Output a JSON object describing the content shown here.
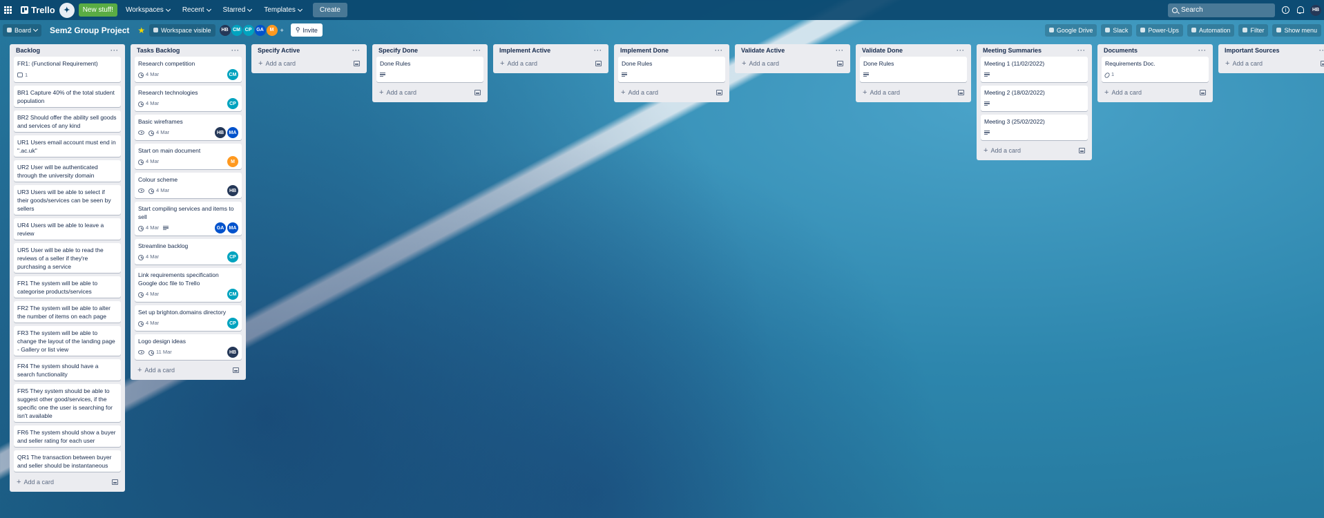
{
  "topbar": {
    "logo": "Trello",
    "new_stuff": "New stuff!",
    "workspaces": "Workspaces",
    "recent": "Recent",
    "starred": "Starred",
    "templates": "Templates",
    "create": "Create",
    "search_placeholder": "Search",
    "info": "i",
    "user_initials": "HB"
  },
  "board": {
    "view": "Board",
    "title": "Sem2 Group Project",
    "visibility": "Workspace visible",
    "members": [
      "HB",
      "CM",
      "CP",
      "GA",
      "M"
    ],
    "invite": "Invite",
    "google_drive": "Google Drive",
    "slack": "Slack",
    "powerups": "Power-Ups",
    "automation": "Automation",
    "filter": "Filter",
    "show_menu": "Show menu",
    "add_card": "Add a card"
  },
  "lists": [
    {
      "name": "Backlog",
      "cards": [
        {
          "title": "FR1: (Functional Requirement)",
          "comments": "1"
        },
        {
          "title": "BR1 Capture 40% of the total student population"
        },
        {
          "title": "BR2 Should offer the ability sell goods and services of any kind"
        },
        {
          "title": "UR1 Users email account must end in \".ac.uk\""
        },
        {
          "title": "UR2 User will be authenticated through the university domain"
        },
        {
          "title": "UR3 Users will be able to select if their goods/services can be seen by sellers"
        },
        {
          "title": "UR4 Users will be able to leave a review"
        },
        {
          "title": "UR5 User will be able to read the reviews of a seller if they're purchasing a service"
        },
        {
          "title": "FR1 The system will be able to categorise products/services"
        },
        {
          "title": "FR2 The system will be able to alter the number of items on each page"
        },
        {
          "title": "FR3 The system will be able to change the layout of the landing page - Gallery or list view"
        },
        {
          "title": "FR4 The system should have a search functionality"
        },
        {
          "title": "FR5 They system should be able to suggest other good/services, if the specific one the user is searching for isn't available"
        },
        {
          "title": "FR6 The system should show a buyer and seller rating for each user"
        },
        {
          "title": "QR1 The transaction between buyer and seller should be instantaneous"
        }
      ]
    },
    {
      "name": "Tasks Backlog",
      "cards": [
        {
          "title": "Research competition",
          "due": "4 Mar",
          "members": [
            "CM"
          ]
        },
        {
          "title": "Research technologies",
          "due": "4 Mar",
          "members": [
            "CP"
          ]
        },
        {
          "title": "Basic wireframes",
          "watch": true,
          "due": "4 Mar",
          "members": [
            "HB",
            "MA"
          ]
        },
        {
          "title": "Start on main document",
          "due": "4 Mar",
          "members": [
            "M"
          ]
        },
        {
          "title": "Colour scheme",
          "watch": true,
          "due": "4 Mar",
          "members": [
            "HB"
          ]
        },
        {
          "title": "Start compiling services and items to sell",
          "due": "4 Mar",
          "desc": true,
          "members": [
            "GA",
            "MA"
          ]
        },
        {
          "title": "Streamline backlog",
          "due": "4 Mar",
          "members": [
            "CP"
          ]
        },
        {
          "title": "Link requirements specification Google doc file to Trello",
          "due": "4 Mar",
          "members": [
            "CM"
          ]
        },
        {
          "title": "Set up brighton.domains directory",
          "due": "4 Mar",
          "members": [
            "CP"
          ]
        },
        {
          "title": "Logo design ideas",
          "watch": true,
          "due": "11 Mar",
          "members": [
            "HB"
          ]
        }
      ]
    },
    {
      "name": "Specify Active",
      "cards": []
    },
    {
      "name": "Specify Done",
      "cards": [
        {
          "title": "Done Rules",
          "desc": true
        }
      ]
    },
    {
      "name": "Implement Active",
      "cards": []
    },
    {
      "name": "Implement Done",
      "cards": [
        {
          "title": "Done Rules",
          "desc": true
        }
      ]
    },
    {
      "name": "Validate Active",
      "cards": []
    },
    {
      "name": "Validate Done",
      "cards": [
        {
          "title": "Done Rules",
          "desc": true
        }
      ]
    },
    {
      "name": "Meeting Summaries",
      "cards": [
        {
          "title": "Meeting 1 (11/02/2022)",
          "desc": true
        },
        {
          "title": "Meeting 2 (18/02/2022)",
          "desc": true
        },
        {
          "title": "Meeting 3 (25/02/2022)",
          "desc": true
        }
      ]
    },
    {
      "name": "Documents",
      "cards": [
        {
          "title": "Requirements Doc.",
          "attachments": "1"
        }
      ]
    },
    {
      "name": "Important Sources",
      "cards": []
    }
  ],
  "colors": {
    "topbar": "#0a466e",
    "new_stuff": "#5aac44",
    "list_bg": "#ebecf0",
    "text": "#172b4d",
    "muted": "#5e6c84"
  }
}
